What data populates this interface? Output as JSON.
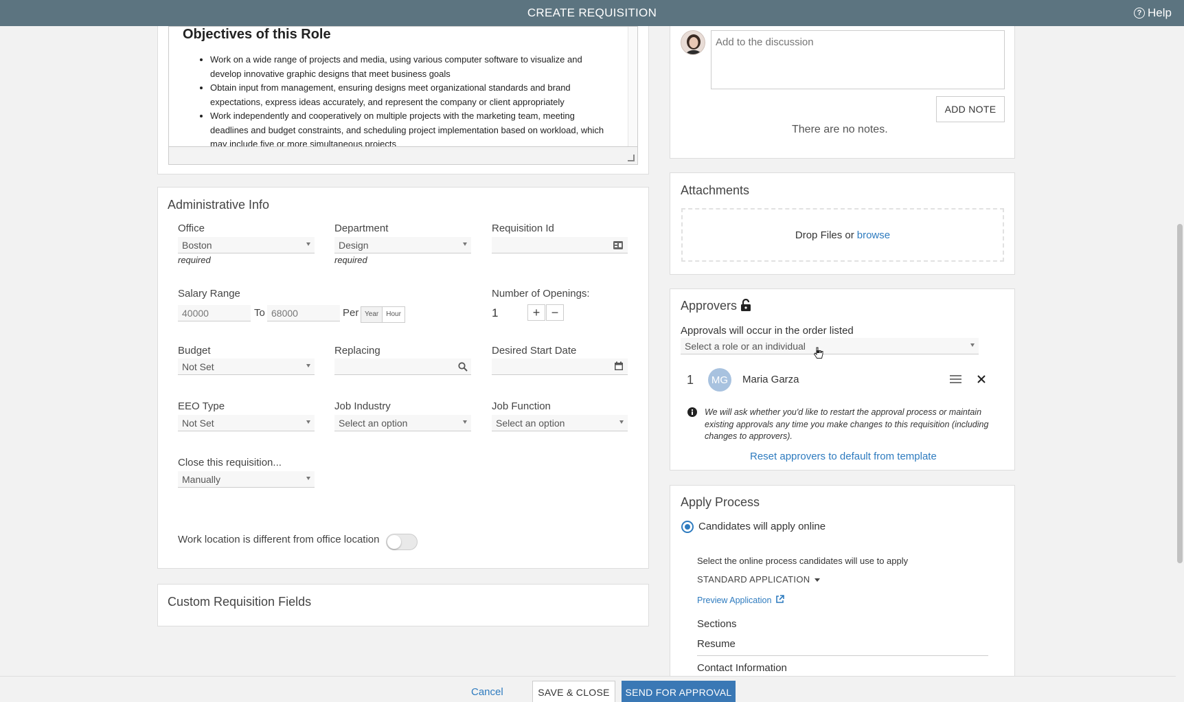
{
  "header": {
    "title": "CREATE REQUISITION",
    "help_label": "Help"
  },
  "editor": {
    "heading": "Objectives of this Role",
    "bullets": [
      "Work on a wide range of projects and media, using various computer software to visualize and develop innovative graphic designs that meet business goals",
      "Obtain input from management, ensuring designs meet organizational standards and brand expectations, express ideas accurately, and represent the company or client appropriately",
      "Work independently and cooperatively on multiple projects with the marketing team, meeting deadlines and budget constraints, and scheduling project implementation based on workload, which may include five or more simultaneous projects"
    ]
  },
  "admin": {
    "title": "Administrative Info",
    "office": {
      "label": "Office",
      "value": "Boston",
      "hint": "required"
    },
    "department": {
      "label": "Department",
      "value": "Design",
      "hint": "required"
    },
    "requisition_id": {
      "label": "Requisition Id",
      "value": ""
    },
    "salary": {
      "label": "Salary Range",
      "from": "40000",
      "to_label": "To",
      "to": "68000",
      "per_label": "Per",
      "year": "Year",
      "hour": "Hour"
    },
    "openings": {
      "label": "Number of Openings:",
      "value": "1",
      "plus": "+",
      "minus": "−"
    },
    "budget": {
      "label": "Budget",
      "value": "Not Set"
    },
    "replacing": {
      "label": "Replacing",
      "value": ""
    },
    "start_date": {
      "label": "Desired Start Date",
      "value": ""
    },
    "eeo": {
      "label": "EEO Type",
      "value": "Not Set"
    },
    "industry": {
      "label": "Job Industry",
      "value": "Select an option"
    },
    "function": {
      "label": "Job Function",
      "value": "Select an option"
    },
    "close": {
      "label": "Close this requisition...",
      "value": "Manually"
    },
    "work_location": {
      "label": "Work location is different from office location",
      "enabled": false
    }
  },
  "custom_fields": {
    "title": "Custom Requisition Fields"
  },
  "notes": {
    "placeholder": "Add to the discussion",
    "add_label": "ADD NOTE",
    "empty": "There are no notes."
  },
  "attachments": {
    "title": "Attachments",
    "drop_text": "Drop Files or",
    "browse_label": "browse"
  },
  "approvers": {
    "title": "Approvers",
    "order_text": "Approvals will occur in the order listed",
    "select_placeholder": "Select a role or an individual",
    "list": [
      {
        "index": "1",
        "initials": "MG",
        "name": "Maria Garza"
      }
    ],
    "info": "We will ask whether you'd like to restart the approval process or maintain existing approvals any time you make changes to this requisition (including changes to approvers).",
    "reset_label": "Reset approvers to default from template"
  },
  "apply": {
    "title": "Apply Process",
    "option_label": "Candidates will apply online",
    "select_text": "Select the online process candidates will use to apply",
    "application": "STANDARD APPLICATION",
    "preview_label": "Preview Application",
    "sections_label": "Sections",
    "sections": [
      "Resume",
      "Contact Information"
    ]
  },
  "footer": {
    "cancel": "Cancel",
    "save_close": "SAVE & CLOSE",
    "send": "SEND FOR APPROVAL"
  },
  "colors": {
    "header_bg": "#5c7480",
    "primary": "#3a78b5",
    "link": "#2e7bbf",
    "avatar": "#a8c2df"
  }
}
